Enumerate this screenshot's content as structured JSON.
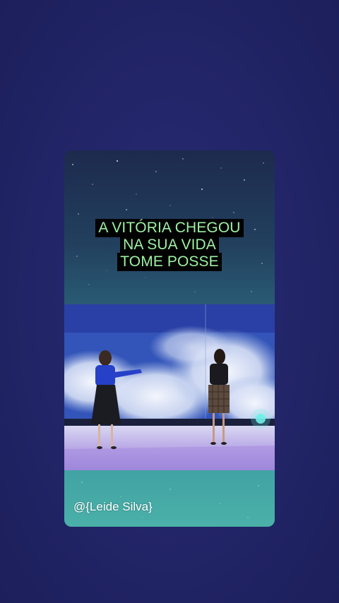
{
  "story": {
    "caption_lines": [
      "A VITÓRIA CHEGOU",
      "NA SUA VIDA",
      "TOME POSSE"
    ],
    "watermark": "@{Leide Silva}"
  },
  "colors": {
    "page_background": "#23266a",
    "caption_text": "#9ef0a4",
    "caption_background": "#000000",
    "card_gradient_top": "#1d2a4e",
    "card_gradient_bottom": "#4ab0a8"
  },
  "video": {
    "scene": "stage-performance"
  }
}
